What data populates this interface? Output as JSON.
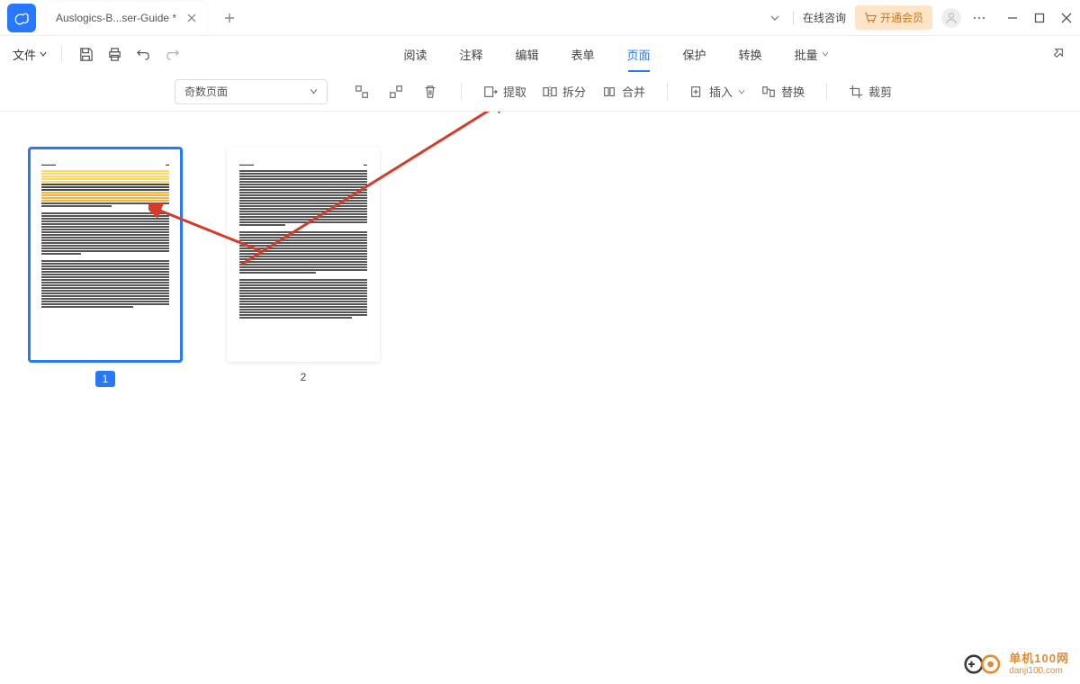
{
  "title_bar": {
    "tab_title": "Auslogics-B...ser-Guide *",
    "online_inquiry": "在线咨询",
    "vip_button": "开通会员"
  },
  "menu_bar": {
    "file_menu": "文件",
    "tabs": {
      "read": "阅读",
      "annotate": "注释",
      "edit": "编辑",
      "form": "表单",
      "page": "页面",
      "protect": "保护",
      "convert": "转换",
      "batch": "批量"
    }
  },
  "toolbar": {
    "page_select_value": "奇数页面",
    "extract": "提取",
    "split": "拆分",
    "merge": "合并",
    "insert": "插入",
    "replace": "替换",
    "crop": "裁剪"
  },
  "pages": [
    {
      "number": "1",
      "selected": true
    },
    {
      "number": "2",
      "selected": false
    }
  ],
  "watermark": {
    "line1": "单机100网",
    "line2": "danji100.com"
  }
}
